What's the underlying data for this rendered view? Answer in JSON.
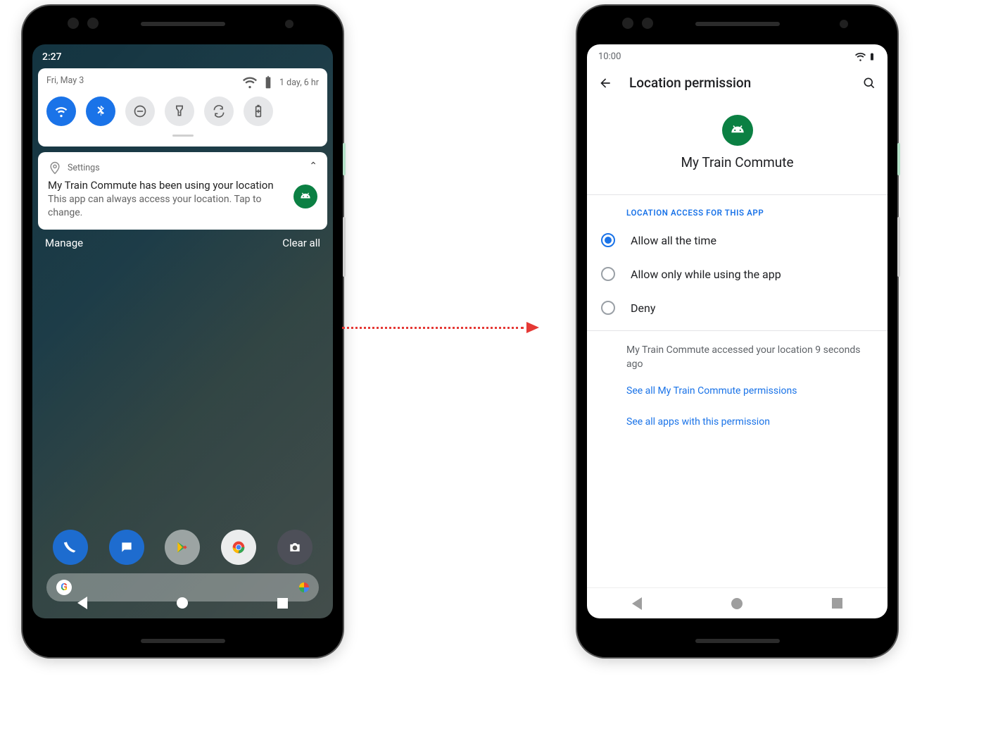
{
  "left": {
    "status_time": "2:27",
    "shade": {
      "date": "Fri, May 3",
      "battery_text": "1 day, 6 hr",
      "tiles": [
        {
          "name": "wifi",
          "active": true
        },
        {
          "name": "bluetooth",
          "active": true
        },
        {
          "name": "dnd",
          "active": false
        },
        {
          "name": "flashlight",
          "active": false
        },
        {
          "name": "autorotate",
          "active": false
        },
        {
          "name": "battery",
          "active": false
        }
      ]
    },
    "notification": {
      "source": "Settings",
      "title": "My Train Commute has been using your location",
      "body": "This app can always access your location. Tap to change."
    },
    "actions": {
      "manage": "Manage",
      "clear": "Clear all"
    }
  },
  "right": {
    "status_time": "10:00",
    "page_title": "Location permission",
    "app_name": "My Train Commute",
    "section_label": "LOCATION ACCESS FOR THIS APP",
    "options": [
      {
        "label": "Allow all the time",
        "selected": true
      },
      {
        "label": "Allow only while using the app",
        "selected": false
      },
      {
        "label": "Deny",
        "selected": false
      }
    ],
    "access_info": "My Train Commute accessed your location 9 seconds ago",
    "links": {
      "app_permissions": "See all My Train Commute permissions",
      "apps_with_permission": "See all apps with this permission"
    }
  }
}
